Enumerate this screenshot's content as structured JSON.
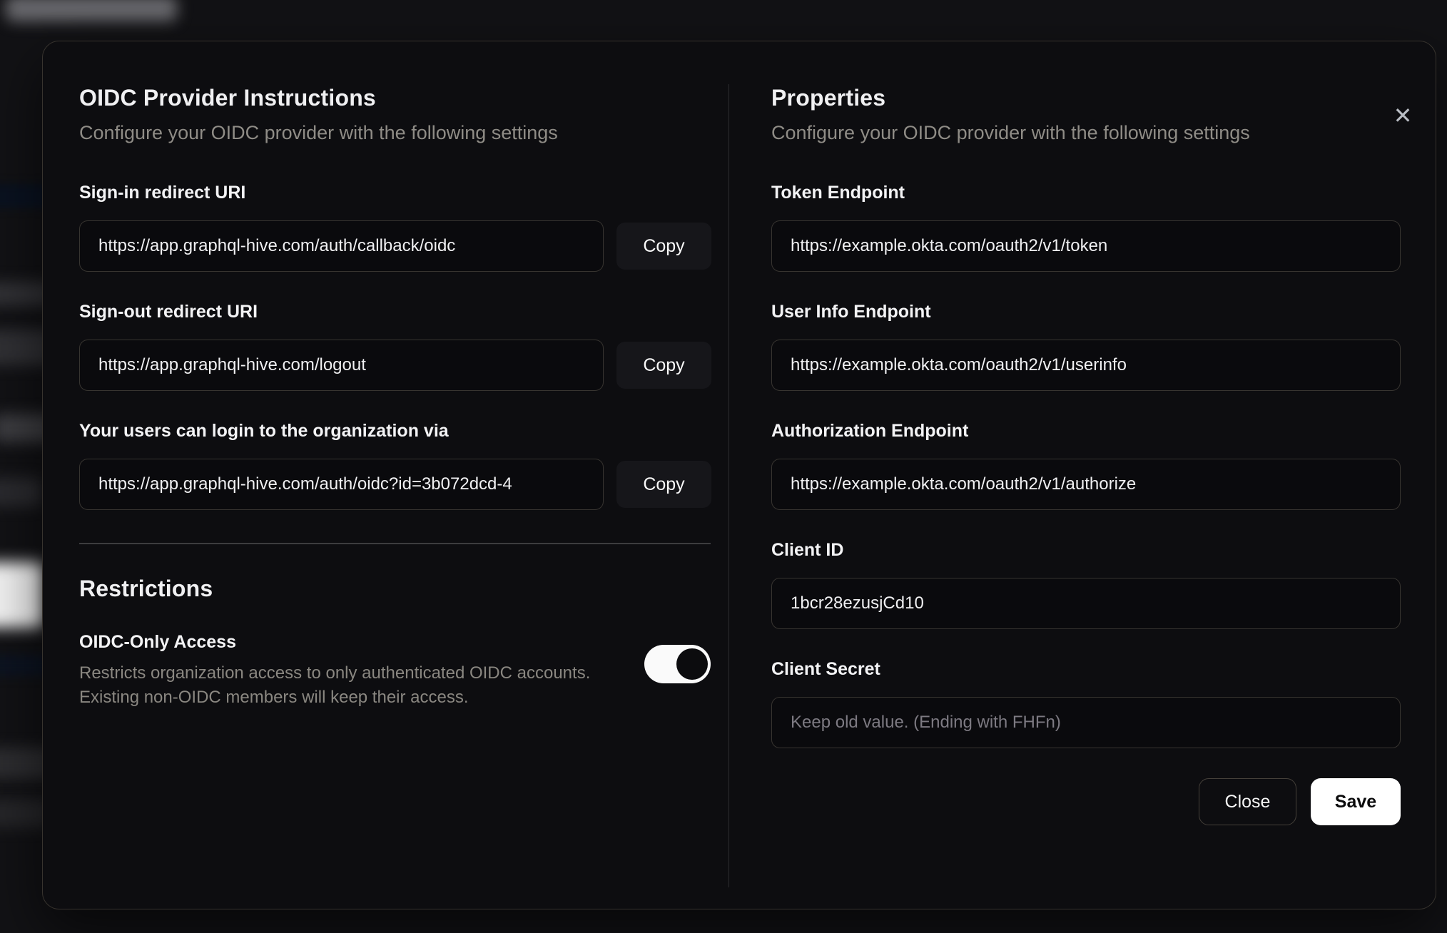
{
  "modal": {
    "close_icon": "✕",
    "left": {
      "title": "OIDC Provider Instructions",
      "subtitle": "Configure your OIDC provider with the following settings",
      "fields": [
        {
          "label": "Sign-in redirect URI",
          "value": "https://app.graphql-hive.com/auth/callback/oidc",
          "copy_label": "Copy"
        },
        {
          "label": "Sign-out redirect URI",
          "value": "https://app.graphql-hive.com/logout",
          "copy_label": "Copy"
        },
        {
          "label": "Your users can login to the organization via",
          "value": "https://app.graphql-hive.com/auth/oidc?id=3b072dcd-4",
          "copy_label": "Copy"
        }
      ],
      "restrictions": {
        "title": "Restrictions",
        "toggle_label": "OIDC-Only Access",
        "description_line1": "Restricts organization access to only authenticated OIDC accounts.",
        "description_line2": "Existing non-OIDC members will keep their access.",
        "toggle_state": "on"
      }
    },
    "right": {
      "title": "Properties",
      "subtitle": "Configure your OIDC provider with the following settings",
      "fields": [
        {
          "label": "Token Endpoint",
          "value": "https://example.okta.com/oauth2/v1/token"
        },
        {
          "label": "User Info Endpoint",
          "value": "https://example.okta.com/oauth2/v1/userinfo"
        },
        {
          "label": "Authorization Endpoint",
          "value": "https://example.okta.com/oauth2/v1/authorize"
        },
        {
          "label": "Client ID",
          "value": "1bcr28ezusjCd10"
        },
        {
          "label": "Client Secret",
          "value": "",
          "placeholder": "Keep old value. (Ending with FHFn)"
        }
      ],
      "buttons": {
        "close": "Close",
        "save": "Save"
      }
    }
  },
  "colors": {
    "page_background": "#121215",
    "modal_background": "#0d0d10",
    "modal_border": "#37332e",
    "input_background": "#0a0a0d",
    "input_border": "#373430",
    "muted_text": "#8f8c86",
    "toggle_on_track": "#fafafa",
    "toggle_thumb": "#0c0c0e",
    "save_button_background": "#ffffff",
    "save_button_text": "#0b0b0c"
  }
}
